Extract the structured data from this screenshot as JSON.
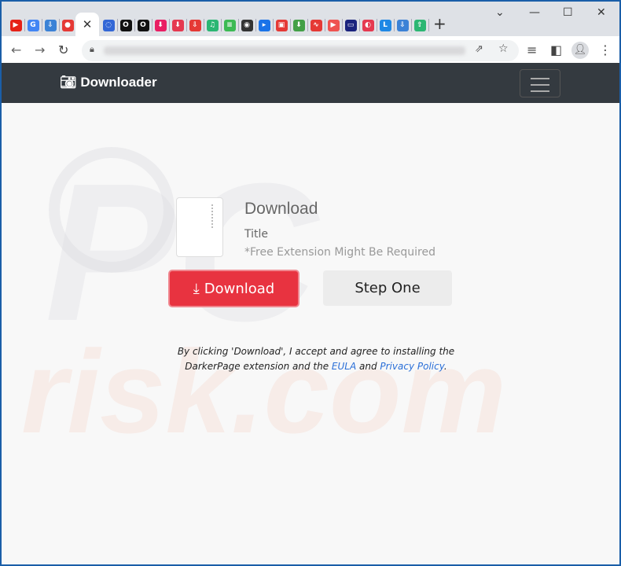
{
  "browser": {
    "tabs": [
      {
        "icon": "youtube-icon",
        "color": "#e62117",
        "glyph": "▶"
      },
      {
        "icon": "google-icon",
        "color": "#4285f4",
        "glyph": "G"
      },
      {
        "icon": "cloud-download-icon",
        "color": "#3b82d6",
        "glyph": "⇩"
      },
      {
        "icon": "red-chat-icon",
        "color": "#e53935",
        "glyph": "●"
      },
      {
        "icon": "close-icon",
        "active": true,
        "glyph": "✕"
      },
      {
        "icon": "loading-icon",
        "color": "#3367d6",
        "glyph": "◌"
      },
      {
        "icon": "opera-icon",
        "color": "#111",
        "glyph": "O"
      },
      {
        "icon": "opera-icon",
        "color": "#111",
        "glyph": "O"
      },
      {
        "icon": "download-icon",
        "color": "#e91e63",
        "glyph": "⬇"
      },
      {
        "icon": "download-icon",
        "color": "#e53950",
        "glyph": "⬇"
      },
      {
        "icon": "cloud-download-icon",
        "color": "#e53935",
        "glyph": "⇩"
      },
      {
        "icon": "music-icon",
        "color": "#2bb673",
        "glyph": "♫"
      },
      {
        "icon": "list-icon",
        "color": "#3cba54",
        "glyph": "≡"
      },
      {
        "icon": "speaker-icon",
        "color": "#333",
        "glyph": "◉"
      },
      {
        "icon": "play-icon",
        "color": "#1a73e8",
        "glyph": "▸"
      },
      {
        "icon": "video-icon",
        "color": "#e53935",
        "glyph": "▣"
      },
      {
        "icon": "download-icon",
        "color": "#43a047",
        "glyph": "⬇"
      },
      {
        "icon": "audio-wave-icon",
        "color": "#e53935",
        "glyph": "∿"
      },
      {
        "icon": "play-icon",
        "color": "#ef5350",
        "glyph": "▶"
      },
      {
        "icon": "tv-icon",
        "color": "#1a237e",
        "glyph": "▭"
      },
      {
        "icon": "record-icon",
        "color": "#e53950",
        "glyph": "◐"
      },
      {
        "icon": "letter-l-icon",
        "color": "#1e88e5",
        "glyph": "L"
      },
      {
        "icon": "cloud-download-icon",
        "color": "#3b82d6",
        "glyph": "⇩"
      },
      {
        "icon": "cloud-upload-icon",
        "color": "#2bb673",
        "glyph": "⇧"
      }
    ],
    "new_tab": "+",
    "window_controls": {
      "dropdown": "⌄",
      "minimize": "—",
      "maximize": "☐",
      "close": "✕"
    }
  },
  "navbar": {
    "brand": "Downloader",
    "brand_icon": "camera-icon"
  },
  "main": {
    "heading": "Download",
    "title": "Title",
    "note": "*Free Extension Might Be Required",
    "download_button": "Download",
    "step_button": "Step One",
    "legal": {
      "part1": "By clicking 'Download', I accept and agree to installing the DarkerPage extension and the ",
      "eula": "EULA",
      "and": " and ",
      "privacy": "Privacy Policy",
      "end": "."
    }
  },
  "colors": {
    "accent": "#e83340",
    "navbar": "#343a40",
    "link": "#2a6fd8",
    "frame": "#1a5ea8"
  }
}
